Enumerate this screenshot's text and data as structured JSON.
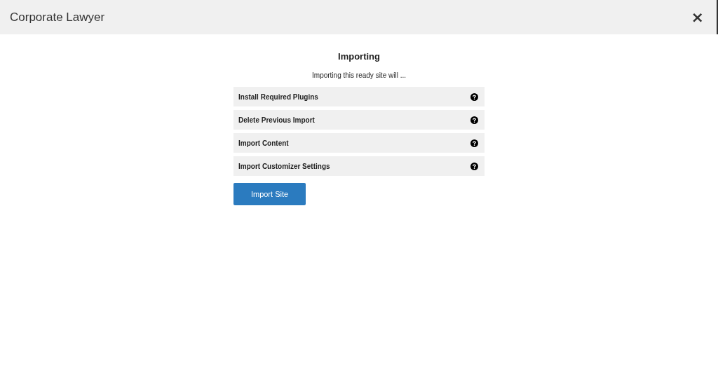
{
  "window": {
    "title": "Corporate Lawyer",
    "close": "×"
  },
  "heading": "Importing",
  "subtitle": "Importing this ready site will ...",
  "steps": [
    {
      "label": "Install Required Plugins"
    },
    {
      "label": "Delete Previous Import"
    },
    {
      "label": "Import Content"
    },
    {
      "label": "Import Customizer Settings"
    }
  ],
  "button": "Import Site"
}
